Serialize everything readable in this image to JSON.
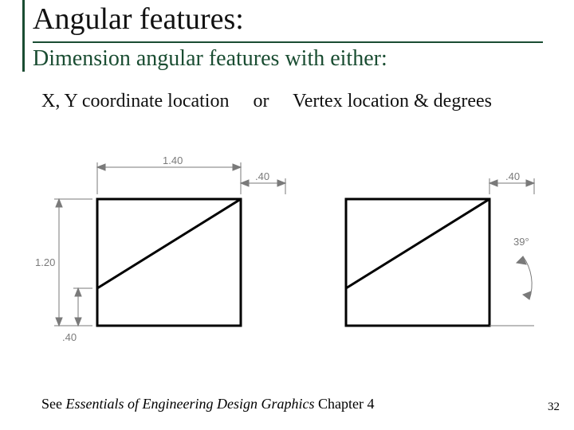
{
  "title": "Angular features:",
  "subtitle": "Dimension angular features with either:",
  "body": {
    "opt1": "X, Y coordinate location",
    "conj": "or",
    "opt2": "Vertex location & degrees"
  },
  "dimensions": {
    "left": {
      "top_major": "1.40",
      "top_minor": ".40",
      "side_major": "1.20",
      "side_minor": ".40"
    },
    "right": {
      "top": ".40",
      "angle": "39°"
    }
  },
  "footer": {
    "prefix": "See ",
    "italic": "Essentials of Engineering Design Graphics",
    "suffix": "  Chapter 4"
  },
  "page_number": "32"
}
